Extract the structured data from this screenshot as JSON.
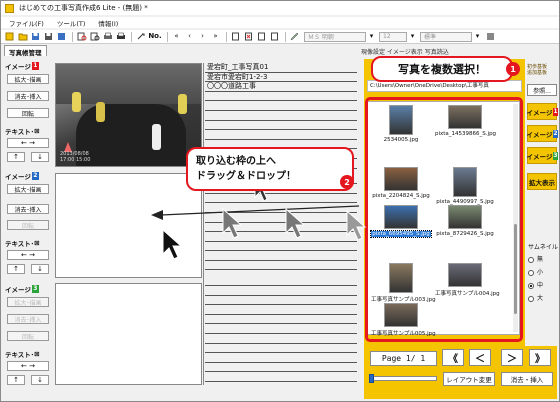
{
  "window": {
    "title": "はじめての工事写真作成6 Lite - (無題)  *"
  },
  "menu": [
    "ファイル(F)",
    "ツール(T)",
    "情報(I)"
  ],
  "toolbar": {
    "numbering_label": "No.",
    "font_name": "ＭＳ 明朝",
    "font_size": "12",
    "font_style": "標準"
  },
  "tabs": {
    "active": "写真帳管理"
  },
  "left_panel": {
    "image_sections": [
      {
        "label": "イメージ",
        "num": "1",
        "badge_color": "#e4171e"
      },
      {
        "label": "イメージ",
        "num": "2",
        "badge_color": "#2468c6"
      },
      {
        "label": "イメージ",
        "num": "3",
        "badge_color": "#2aa33a"
      }
    ],
    "buttons": {
      "expand": "拡大･描画",
      "erase_insert": "消去･挿入",
      "rotate": "回転",
      "text": "テキスト･",
      "text_icon": "⊠"
    },
    "arrows": {
      "left_right": "← →",
      "up": "↑",
      "down": "↓"
    }
  },
  "photo1": {
    "stamp": "2013/08/08\n17:00 15:00"
  },
  "text_lines": [
    "愛宕町_工事写真01",
    "愛宕市愛宕町1-2-3",
    "〇〇〇道路工事"
  ],
  "right_panel": {
    "header": "現像設定  イメージ表示  写真読込",
    "small_labels": [
      "初歩基板",
      "追加基板"
    ],
    "ref_button": "参照...",
    "path": "C:\\Users\\Owner\\OneDrive\\Desktop\\工事写真",
    "thumbnails": [
      {
        "caption": "2534005.jpg",
        "selected": false,
        "tone": "#5a7fa8"
      },
      {
        "caption": "pixta_14539866_S.jpg",
        "selected": false,
        "tone": "#7c7060"
      },
      {
        "caption": "pixta_2204824_S.jpg",
        "selected": false,
        "tone": "#8a6040"
      },
      {
        "caption": "pixta_4490997_S.jpg",
        "selected": false,
        "tone": "#6a7a90"
      },
      {
        "caption": "pixta_6695495_S.jpg",
        "selected": true,
        "tone": "#3c6fae"
      },
      {
        "caption": "pixta_8729426_S.jpg",
        "selected": false,
        "tone": "#7a8a70"
      },
      {
        "caption": "工事写真サンプル003.jpg",
        "selected": false,
        "tone": "#8a7a60"
      },
      {
        "caption": "工事写真サンプル004.jpg",
        "selected": false,
        "tone": "#6a6a78"
      },
      {
        "caption": "工事写真サンプル005.jpg",
        "selected": false,
        "tone": "#7a6a5a"
      }
    ],
    "side_buttons": [
      {
        "label": "イメージ",
        "num": "1",
        "color": "#e4171e"
      },
      {
        "label": "イメージ",
        "num": "2",
        "color": "#2468c6"
      },
      {
        "label": "イメージ",
        "num": "3",
        "color": "#2aa33a"
      }
    ],
    "enlarge_button": "拡大表示",
    "thumbnail_size": {
      "title": "サムネイル",
      "options": [
        "無",
        "小",
        "中",
        "大"
      ],
      "selected": "中"
    }
  },
  "pager": {
    "page_text": "Page  1/ 1",
    "first": "《",
    "prev": "＜",
    "next": "＞",
    "last": "》",
    "layout_change": "レイアウト変更",
    "erase_insert": "消去・挿入",
    "zoom_level": 0.05
  },
  "callouts": {
    "one": {
      "text": "写真を複数選択！",
      "num": "1"
    },
    "two": {
      "line1": "取り込む枠の上へ",
      "line2": "ドラッグ＆ドロップ！",
      "num": "2"
    }
  },
  "colors": {
    "accent_yellow": "#f5c400",
    "callout_red": "#e4171e"
  }
}
